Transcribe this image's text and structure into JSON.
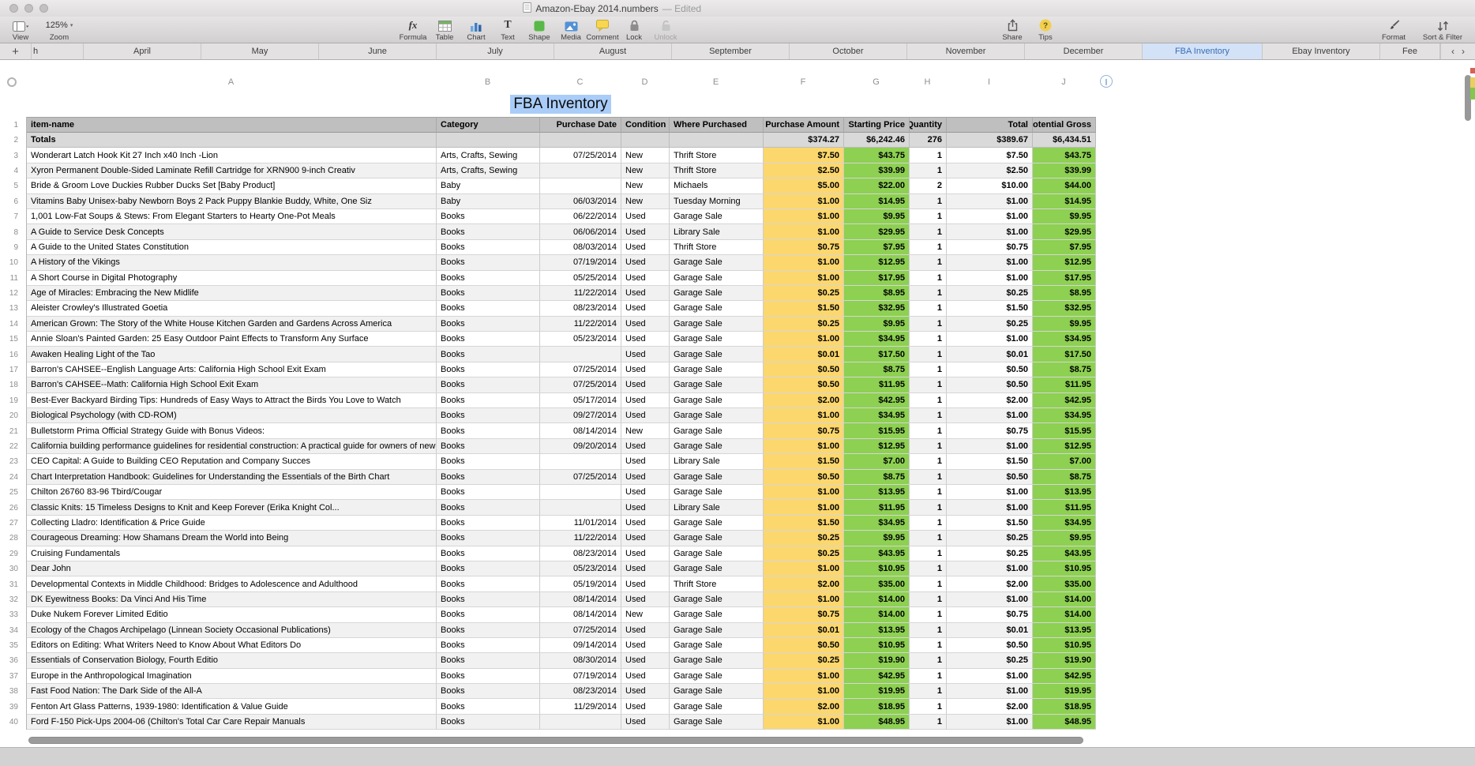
{
  "window": {
    "title": "Amazon-Ebay 2014.numbers",
    "edited": "— Edited"
  },
  "toolbar": {
    "view_label": "View",
    "zoom_value": "125%",
    "zoom_label": "Zoom",
    "center_items": [
      {
        "label": "Formula",
        "icon": "formula"
      },
      {
        "label": "Table",
        "icon": "table"
      },
      {
        "label": "Chart",
        "icon": "chart"
      },
      {
        "label": "Text",
        "icon": "text"
      },
      {
        "label": "Shape",
        "icon": "shape"
      },
      {
        "label": "Media",
        "icon": "media"
      },
      {
        "label": "Comment",
        "icon": "comment"
      },
      {
        "label": "Lock",
        "icon": "lock"
      },
      {
        "label": "Unlock",
        "icon": "unlock",
        "disabled": true
      }
    ],
    "share_label": "Share",
    "tips_label": "Tips",
    "format_label": "Format",
    "sort_filter_label": "Sort & Filter"
  },
  "tabs": {
    "add_label": "+",
    "prev_label": "‹",
    "next_label": "›",
    "items": [
      {
        "label": "h"
      },
      {
        "label": "April"
      },
      {
        "label": "May"
      },
      {
        "label": "June"
      },
      {
        "label": "July"
      },
      {
        "label": "August"
      },
      {
        "label": "September"
      },
      {
        "label": "October"
      },
      {
        "label": "November"
      },
      {
        "label": "December"
      },
      {
        "label": "FBA Inventory",
        "selected": true
      },
      {
        "label": "Ebay Inventory"
      },
      {
        "label": "Fee"
      }
    ]
  },
  "sheet": {
    "title": "FBA Inventory",
    "column_letters": [
      "A",
      "B",
      "C",
      "D",
      "E",
      "F",
      "G",
      "H",
      "I",
      "J"
    ],
    "table": {
      "headers": [
        "item-name",
        "Category",
        "Purchase Date",
        "Condition",
        "Where Purchased",
        "Purchase Amount",
        "Starting Price",
        "Quantity",
        "Total",
        "Potential Gross"
      ],
      "totals": [
        "Totals",
        "",
        "",
        "",
        "",
        "$374.27",
        "$6,242.46",
        "276",
        "$389.67",
        "$6,434.51"
      ],
      "rows": [
        [
          "Wonderart Latch Hook Kit 27 Inch x40 Inch -Lion",
          "Arts, Crafts, Sewing",
          "07/25/2014",
          "New",
          "Thrift Store",
          "$7.50",
          "$43.75",
          "1",
          "$7.50",
          "$43.75"
        ],
        [
          "Xyron Permanent Double-Sided Laminate Refill Cartridge for XRN900 9-inch Creativ",
          "Arts, Crafts, Sewing",
          "",
          "New",
          "Thrift Store",
          "$2.50",
          "$39.99",
          "1",
          "$2.50",
          "$39.99"
        ],
        [
          "Bride & Groom Love Duckies Rubber Ducks Set [Baby Product]",
          "Baby",
          "",
          "New",
          "Michaels",
          "$5.00",
          "$22.00",
          "2",
          "$10.00",
          "$44.00"
        ],
        [
          "Vitamins Baby Unisex-baby Newborn Boys 2 Pack Puppy Blankie Buddy, White, One Siz",
          "Baby",
          "06/03/2014",
          "New",
          "Tuesday Morning",
          "$1.00",
          "$14.95",
          "1",
          "$1.00",
          "$14.95"
        ],
        [
          "1,001 Low-Fat Soups & Stews: From Elegant Starters to Hearty One-Pot Meals",
          "Books",
          "06/22/2014",
          "Used",
          "Garage Sale",
          "$1.00",
          "$9.95",
          "1",
          "$1.00",
          "$9.95"
        ],
        [
          "A Guide to Service Desk Concepts",
          "Books",
          "06/06/2014",
          "Used",
          "Library Sale",
          "$1.00",
          "$29.95",
          "1",
          "$1.00",
          "$29.95"
        ],
        [
          "A Guide to the United States Constitution",
          "Books",
          "08/03/2014",
          "Used",
          "Thrift Store",
          "$0.75",
          "$7.95",
          "1",
          "$0.75",
          "$7.95"
        ],
        [
          "A History of the Vikings",
          "Books",
          "07/19/2014",
          "Used",
          "Garage Sale",
          "$1.00",
          "$12.95",
          "1",
          "$1.00",
          "$12.95"
        ],
        [
          "A Short Course in Digital Photography",
          "Books",
          "05/25/2014",
          "Used",
          "Garage Sale",
          "$1.00",
          "$17.95",
          "1",
          "$1.00",
          "$17.95"
        ],
        [
          "Age of Miracles: Embracing the New Midlife",
          "Books",
          "11/22/2014",
          "Used",
          "Garage Sale",
          "$0.25",
          "$8.95",
          "1",
          "$0.25",
          "$8.95"
        ],
        [
          "Aleister Crowley's Illustrated Goetia",
          "Books",
          "08/23/2014",
          "Used",
          "Garage Sale",
          "$1.50",
          "$32.95",
          "1",
          "$1.50",
          "$32.95"
        ],
        [
          "American Grown: The Story of the White House Kitchen Garden and Gardens Across America",
          "Books",
          "11/22/2014",
          "Used",
          "Garage Sale",
          "$0.25",
          "$9.95",
          "1",
          "$0.25",
          "$9.95"
        ],
        [
          "Annie Sloan's Painted Garden: 25 Easy Outdoor Paint Effects to Transform Any Surface",
          "Books",
          "05/23/2014",
          "Used",
          "Garage Sale",
          "$1.00",
          "$34.95",
          "1",
          "$1.00",
          "$34.95"
        ],
        [
          "Awaken Healing Light of the Tao",
          "Books",
          "",
          "Used",
          "Garage Sale",
          "$0.01",
          "$17.50",
          "1",
          "$0.01",
          "$17.50"
        ],
        [
          "Barron's CAHSEE--English Language Arts: California High School Exit Exam",
          "Books",
          "07/25/2014",
          "Used",
          "Garage Sale",
          "$0.50",
          "$8.75",
          "1",
          "$0.50",
          "$8.75"
        ],
        [
          "Barron's CAHSEE--Math: California High School Exit Exam",
          "Books",
          "07/25/2014",
          "Used",
          "Garage Sale",
          "$0.50",
          "$11.95",
          "1",
          "$0.50",
          "$11.95"
        ],
        [
          "Best-Ever Backyard Birding Tips: Hundreds of Easy Ways to Attract the Birds You Love to Watch",
          "Books",
          "05/17/2014",
          "Used",
          "Garage Sale",
          "$2.00",
          "$42.95",
          "1",
          "$2.00",
          "$42.95"
        ],
        [
          "Biological Psychology (with CD-ROM)",
          "Books",
          "09/27/2014",
          "Used",
          "Garage Sale",
          "$1.00",
          "$34.95",
          "1",
          "$1.00",
          "$34.95"
        ],
        [
          "Bulletstorm Prima Official Strategy Guide with Bonus Videos:",
          "Books",
          "08/14/2014",
          "New",
          "Garage Sale",
          "$0.75",
          "$15.95",
          "1",
          "$0.75",
          "$15.95"
        ],
        [
          "California building performance guidelines for residential construction: A practical guide for owners of new homes : constr",
          "Books",
          "09/20/2014",
          "Used",
          "Garage Sale",
          "$1.00",
          "$12.95",
          "1",
          "$1.00",
          "$12.95"
        ],
        [
          "CEO Capital: A Guide to Building CEO Reputation and Company Succes",
          "Books",
          "",
          "Used",
          "Library Sale",
          "$1.50",
          "$7.00",
          "1",
          "$1.50",
          "$7.00"
        ],
        [
          "Chart Interpretation Handbook: Guidelines for Understanding the Essentials of the Birth Chart",
          "Books",
          "07/25/2014",
          "Used",
          "Garage Sale",
          "$0.50",
          "$8.75",
          "1",
          "$0.50",
          "$8.75"
        ],
        [
          "Chilton 26760 83-96 Tbird/Cougar",
          "Books",
          "",
          "Used",
          "Garage Sale",
          "$1.00",
          "$13.95",
          "1",
          "$1.00",
          "$13.95"
        ],
        [
          "Classic Knits: 15 Timeless Designs to Knit and Keep Forever (Erika Knight Col...",
          "Books",
          "",
          "Used",
          "Library Sale",
          "$1.00",
          "$11.95",
          "1",
          "$1.00",
          "$11.95"
        ],
        [
          "Collecting Lladro: Identification & Price Guide",
          "Books",
          "11/01/2014",
          "Used",
          "Garage Sale",
          "$1.50",
          "$34.95",
          "1",
          "$1.50",
          "$34.95"
        ],
        [
          "Courageous Dreaming: How Shamans Dream the World into Being",
          "Books",
          "11/22/2014",
          "Used",
          "Garage Sale",
          "$0.25",
          "$9.95",
          "1",
          "$0.25",
          "$9.95"
        ],
        [
          "Cruising Fundamentals",
          "Books",
          "08/23/2014",
          "Used",
          "Garage Sale",
          "$0.25",
          "$43.95",
          "1",
          "$0.25",
          "$43.95"
        ],
        [
          "Dear John",
          "Books",
          "05/23/2014",
          "Used",
          "Garage Sale",
          "$1.00",
          "$10.95",
          "1",
          "$1.00",
          "$10.95"
        ],
        [
          "Developmental Contexts in Middle Childhood: Bridges to Adolescence and Adulthood",
          "Books",
          "05/19/2014",
          "Used",
          "Thrift Store",
          "$2.00",
          "$35.00",
          "1",
          "$2.00",
          "$35.00"
        ],
        [
          "DK Eyewitness Books: Da Vinci And His Time",
          "Books",
          "08/14/2014",
          "Used",
          "Garage Sale",
          "$1.00",
          "$14.00",
          "1",
          "$1.00",
          "$14.00"
        ],
        [
          "Duke Nukem Forever Limited Editio",
          "Books",
          "08/14/2014",
          "New",
          "Garage Sale",
          "$0.75",
          "$14.00",
          "1",
          "$0.75",
          "$14.00"
        ],
        [
          "Ecology of the Chagos Archipelago (Linnean Society Occasional Publications)",
          "Books",
          "07/25/2014",
          "Used",
          "Garage Sale",
          "$0.01",
          "$13.95",
          "1",
          "$0.01",
          "$13.95"
        ],
        [
          "Editors on Editing: What Writers Need to Know About What Editors Do",
          "Books",
          "09/14/2014",
          "Used",
          "Garage Sale",
          "$0.50",
          "$10.95",
          "1",
          "$0.50",
          "$10.95"
        ],
        [
          "Essentials of Conservation Biology, Fourth Editio",
          "Books",
          "08/30/2014",
          "Used",
          "Garage Sale",
          "$0.25",
          "$19.90",
          "1",
          "$0.25",
          "$19.90"
        ],
        [
          "Europe in the Anthropological Imagination",
          "Books",
          "07/19/2014",
          "Used",
          "Garage Sale",
          "$1.00",
          "$42.95",
          "1",
          "$1.00",
          "$42.95"
        ],
        [
          "Fast Food Nation: The Dark Side of the All-A",
          "Books",
          "08/23/2014",
          "Used",
          "Garage Sale",
          "$1.00",
          "$19.95",
          "1",
          "$1.00",
          "$19.95"
        ],
        [
          "Fenton Art Glass Patterns, 1939-1980: Identification & Value Guide",
          "Books",
          "11/29/2014",
          "Used",
          "Garage Sale",
          "$2.00",
          "$18.95",
          "1",
          "$2.00",
          "$18.95"
        ],
        [
          "Ford F-150 Pick-Ups 2004-06 (Chilton's Total Car Care Repair Manuals",
          "Books",
          "",
          "Used",
          "Garage Sale",
          "$1.00",
          "$48.95",
          "1",
          "$1.00",
          "$48.95"
        ]
      ]
    }
  },
  "colors": {
    "purchase_amount_fill": "#fbd76d",
    "price_fill": "#8dd052",
    "header_fill": "#bfbfbf",
    "totals_fill": "#d9d9d9",
    "title_selection": "#a9cdf8",
    "selected_tab_bg": "#d3e2f7",
    "selected_tab_text": "#3a6db3"
  }
}
